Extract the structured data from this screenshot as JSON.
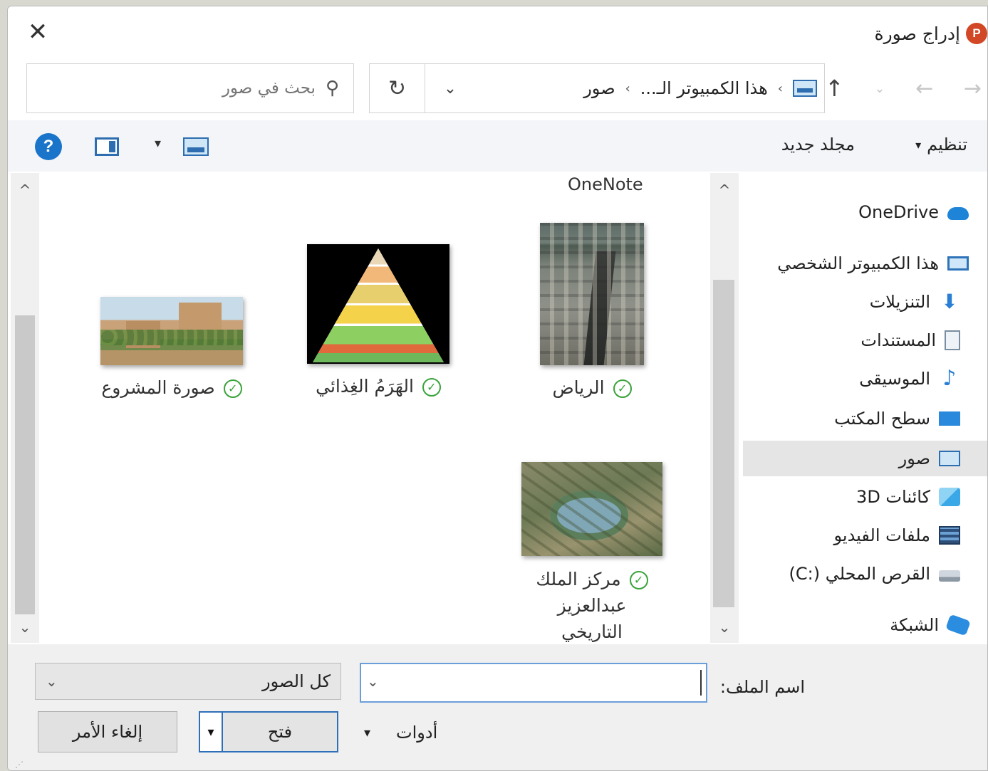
{
  "window": {
    "title": "إدراج صورة",
    "app_icon_letter": "P",
    "close_glyph": "✕"
  },
  "nav": {
    "back_glyph": "→",
    "forward_glyph": "←",
    "recent_glyph": "⌄",
    "up_glyph": "↑",
    "breadcrumbs": [
      "هذا الكمبيوتر الـ...",
      "صور"
    ],
    "crumb_separator": "›",
    "dropdown_glyph": "⌄",
    "refresh_glyph": "↻",
    "search_placeholder": "بحث في صور"
  },
  "toolbar": {
    "organize_label": "تنظيم",
    "organize_arrow": "▾",
    "new_folder_label": "مجلد جديد",
    "view_dropdown_glyph": "▾",
    "help_glyph": "?"
  },
  "sidebar": {
    "items": [
      {
        "label": "OneDrive",
        "icon": "cloud-icon"
      },
      {
        "label": "هذا الكمبيوتر الشخصي",
        "icon": "computer-icon"
      },
      {
        "label": "التنزيلات",
        "icon": "downloads-icon"
      },
      {
        "label": "المستندات",
        "icon": "documents-icon"
      },
      {
        "label": "الموسيقى",
        "icon": "music-icon"
      },
      {
        "label": "سطح المكتب",
        "icon": "desktop-icon"
      },
      {
        "label": "صور",
        "icon": "pictures-icon",
        "selected": true
      },
      {
        "label": "كائنات 3D",
        "icon": "3d-objects-icon"
      },
      {
        "label": "ملفات الفيديو",
        "icon": "videos-icon"
      },
      {
        "label": "القرص المحلي (:C)",
        "icon": "local-disk-icon"
      },
      {
        "label": "الشبكة",
        "icon": "network-icon"
      }
    ],
    "music_glyph": "♪",
    "download_glyph": "⬇"
  },
  "files": {
    "partial_top_label": "OneNote",
    "items": [
      {
        "label": "الرياض",
        "synced": true
      },
      {
        "label": "الهَرَمُ الغِذائي",
        "synced": true
      },
      {
        "label": "صورة المشروع",
        "synced": true
      },
      {
        "label_lines": [
          "مركز الملك",
          "عبدالعزيز",
          "التاريخي"
        ],
        "synced": true
      }
    ],
    "check_glyph": "✓",
    "scroll_up_glyph": "^",
    "scroll_down_glyph": "⌄"
  },
  "bottom": {
    "file_name_label": "اسم الملف:",
    "file_name_value": "",
    "dropdown_glyph": "⌄",
    "filter_value": "كل الصور",
    "tools_label": "أدوات",
    "tools_arrow": "▾",
    "open_label": "فتح",
    "open_split_glyph": "▾",
    "cancel_label": "إلغاء الأمر"
  }
}
